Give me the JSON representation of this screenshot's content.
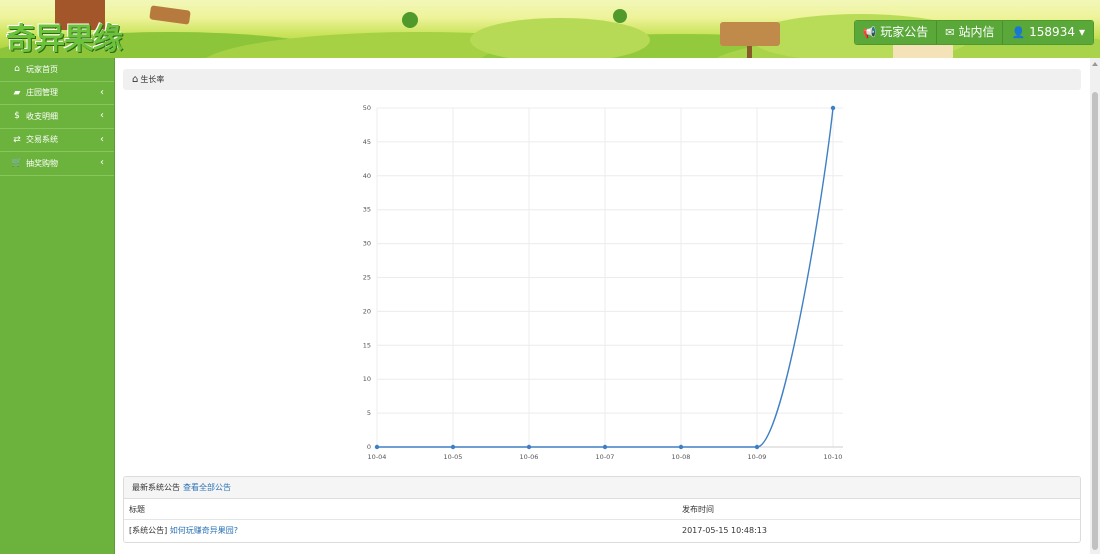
{
  "header": {
    "logo_text": "奇异果缘",
    "nav": [
      {
        "label": "玩家公告",
        "icon": "megaphone-icon",
        "glyph": "📢"
      },
      {
        "label": "站内信",
        "icon": "envelope-icon",
        "glyph": "✉"
      },
      {
        "label": "158934",
        "icon": "user-icon",
        "glyph": "👤",
        "caret": "▾"
      }
    ]
  },
  "sidebar": {
    "items": [
      {
        "label": "玩家首页",
        "icon": "home-icon",
        "glyph": "⌂",
        "chevron": ""
      },
      {
        "label": "庄园管理",
        "icon": "piggy-bank-icon",
        "glyph": "▰",
        "chevron": "‹"
      },
      {
        "label": "收支明细",
        "icon": "dollar-icon",
        "glyph": "$",
        "chevron": "‹"
      },
      {
        "label": "交易系统",
        "icon": "retweet-icon",
        "glyph": "⇄",
        "chevron": "‹"
      },
      {
        "label": "抽奖购物",
        "icon": "cart-icon",
        "glyph": "🛒",
        "chevron": "‹"
      }
    ]
  },
  "breadcrumb": {
    "icon": "home-icon",
    "glyph": "⌂",
    "label": "生长率"
  },
  "chart_data": {
    "type": "line",
    "categories": [
      "10-04",
      "10-05",
      "10-06",
      "10-07",
      "10-08",
      "10-09",
      "10-10"
    ],
    "series": [
      {
        "values": [
          0,
          0,
          0,
          0,
          0,
          0,
          50
        ]
      }
    ],
    "ylim": [
      0,
      50
    ],
    "yticks": [
      0,
      5,
      10,
      15,
      20,
      25,
      30,
      35,
      40,
      45,
      50
    ],
    "grid": true,
    "colors": {
      "line": "#3f7fc4",
      "grid": "#ececec"
    }
  },
  "notice": {
    "heading": "最新系统公告",
    "view_all": "查看全部公告",
    "columns": [
      "标题",
      "发布时间"
    ],
    "rows": [
      {
        "tag": "[系统公告]",
        "title": "如何玩赚奇异果园?",
        "time": "2017-05-15 10:48:13"
      }
    ]
  },
  "colors": {
    "brand_green": "#6bb33c",
    "link_blue": "#2a72b5"
  }
}
